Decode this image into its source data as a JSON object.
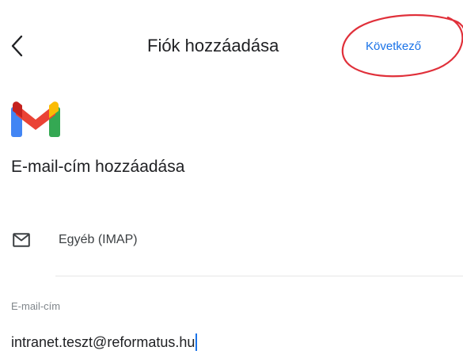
{
  "header": {
    "title": "Fiók hozzáadása",
    "next_label": "Következő"
  },
  "icons": {
    "back": "chevron-left-icon",
    "logo": "gmail-logo",
    "account_type": "mail-icon"
  },
  "colors": {
    "accent": "#1a73e8",
    "annotation": "#e0303a",
    "gmail_red": "#ea4335",
    "gmail_blue": "#4285f4",
    "gmail_green": "#34a853",
    "gmail_yellow": "#fbbc04"
  },
  "main": {
    "heading": "E-mail-cím hozzáadása",
    "account_type": "Egyéb (IMAP)",
    "email": {
      "label": "E-mail-cím",
      "value": "intranet.teszt@reformatus.hu"
    }
  }
}
